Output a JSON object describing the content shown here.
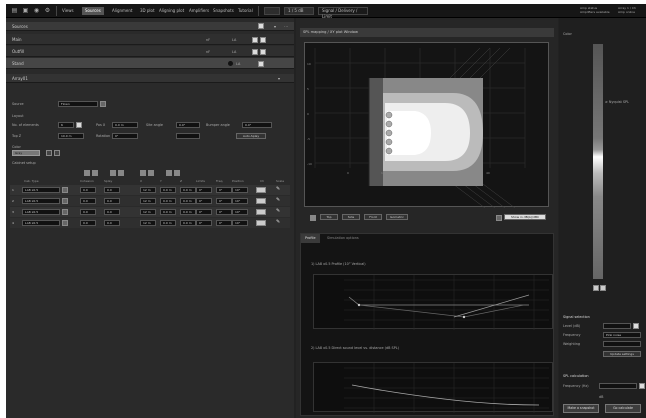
{
  "topbar": {
    "nav": [
      "Views",
      "Sources",
      "Alignment",
      "3D plot",
      "Aligning plot",
      "Amplifiers",
      "Snapshots",
      "Tutorial"
    ],
    "active_nav": "Sources",
    "ctl1": "",
    "ctl2": "1 / 5 dB",
    "ctl3": "Signal / Delivery / Limit",
    "right_line1": "Amp status",
    "right_line2": "Amplifiers available",
    "right_line3": "Array 1 / Ch",
    "right_line4": "Amp online"
  },
  "left": {
    "section_title": "Sources",
    "sources": [
      {
        "name": "Main",
        "a": "nF",
        "b": "LA"
      },
      {
        "name": "Outfill",
        "a": "nF",
        "b": "LA"
      },
      {
        "name": "Stand",
        "a": "",
        "b": "LA"
      }
    ],
    "array_title": "Array01",
    "type_label": "Source",
    "type_value": "Flown",
    "layout_label": "Layout",
    "f1": "No. of elements",
    "f1v": "6",
    "f2": "Pos X",
    "f2v": "0.0 m",
    "f3": "Site angle",
    "f3v": "0.0°",
    "f4": "Bumper angle",
    "f4v": "0.0°",
    "f5": "Top Z",
    "f5v": "10.0 m",
    "f6": "Rotation",
    "f6v": "0°",
    "auto_btn": "Auto-Splay",
    "color_label": "Color",
    "color_value": "Gray",
    "splay_label": "Cabinet setup",
    "table_headers": [
      "",
      "Cab. Type",
      "Cohesion",
      "Splay",
      "X",
      "Y",
      "Z",
      "Limits",
      "Freq.",
      "Position",
      "Ch",
      "Scale"
    ],
    "rows": [
      {
        "n": "1",
        "type": "LA8 x0.5",
        "v": [
          "0.0",
          "0.0",
          "12 m",
          "0.0 m",
          "0.0 m",
          "0°",
          "0°",
          "10°"
        ]
      },
      {
        "n": "2",
        "type": "LA8 x0.5",
        "v": [
          "0.0",
          "0.0",
          "12 m",
          "0.0 m",
          "0.0 m",
          "0°",
          "0°",
          "10°"
        ]
      },
      {
        "n": "3",
        "type": "LA8 x0.5",
        "v": [
          "0.0",
          "0.0",
          "12 m",
          "0.0 m",
          "0.0 m",
          "0°",
          "0°",
          "10°"
        ]
      },
      {
        "n": "4",
        "type": "LA8 x0.5",
        "v": [
          "0.0",
          "0.0",
          "12 m",
          "0.0 m",
          "0.0 m",
          "0°",
          "0°",
          "10°"
        ]
      }
    ]
  },
  "center": {
    "title": "SPL mapping / XY plot Window",
    "buttons": [
      "Top",
      "Side",
      "Front",
      "Isometric"
    ],
    "right_btn": "Show in dB(A)/dBC",
    "tabs": [
      "Profile",
      "Simulation options"
    ],
    "graph1_title": "1) LA8 x0.5 Profile (10° Vertical)",
    "graph2_title": "2) LA8 x0.5 Direct sound level vs. distance (dB SPL)"
  },
  "right": {
    "title": "Color",
    "scale_label": "≥ Nyquist SPL",
    "s1_title": "Signal selection",
    "s1_fields": [
      [
        "Level (dB)",
        ""
      ],
      [
        "Frequency",
        "Pink noise"
      ],
      [
        "Weighting",
        ""
      ]
    ],
    "s1_btn": "Update settings",
    "s2_title": "SPL calculation",
    "s2_field": "Frequency (Hz)",
    "s2_note": "dB",
    "b1": "Make a snapshot",
    "b2": "Go calculate"
  }
}
